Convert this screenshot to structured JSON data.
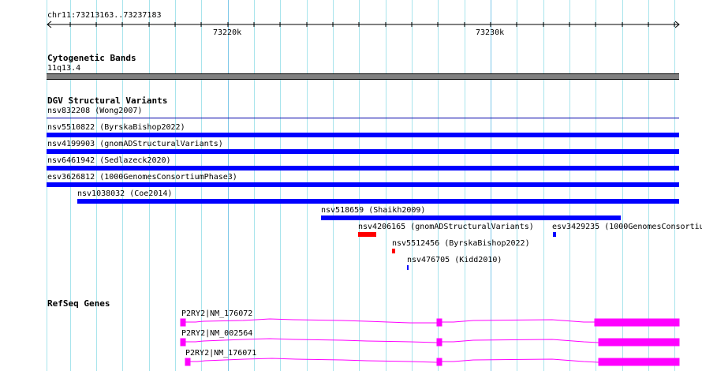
{
  "ruler": {
    "region": "chr11:73213163..73237183",
    "ticks": [
      "73220k",
      "73230k"
    ]
  },
  "cytoband": {
    "title": "Cytogenetic Bands",
    "band": "11q13.4"
  },
  "dgv": {
    "title": "DGV Structural Variants",
    "variants": [
      {
        "label": "nsv832208 (Wong2007)",
        "color": "#0000aa"
      },
      {
        "label": "nsv5510822 (ByrskaBishop2022)",
        "color": "#0000ff"
      },
      {
        "label": "nsv4199903 (gnomADStructuralVariants)",
        "color": "#0000ff"
      },
      {
        "label": "nsv6461942 (Sedlazeck2020)",
        "color": "#0000ff"
      },
      {
        "label": "esv3626812 (1000GenomesConsortiumPhase3)",
        "color": "#0000ff"
      },
      {
        "label": "nsv1038032 (Coe2014)",
        "color": "#0000ff"
      },
      {
        "label": "nsv518659 (Shaikh2009)",
        "color": "#0000ff"
      },
      {
        "label": "nsv4206165 (gnomADStructuralVariants)",
        "color": "#ff0000"
      },
      {
        "label": "esv3429235 (1000GenomesConsortiu",
        "color": "#0000ff"
      },
      {
        "label": "nsv5512456 (ByrskaBishop2022)",
        "color": "#ff0000"
      },
      {
        "label": "nsv476705 (Kidd2010)",
        "color": "#0000ff"
      }
    ]
  },
  "refseq": {
    "title": "RefSeq Genes",
    "color": "#ff00ff",
    "transcripts": [
      {
        "label": "P2RY2|NM_176072"
      },
      {
        "label": "P2RY2|NM_002564"
      },
      {
        "label": "P2RY2|NM_176071"
      }
    ]
  }
}
